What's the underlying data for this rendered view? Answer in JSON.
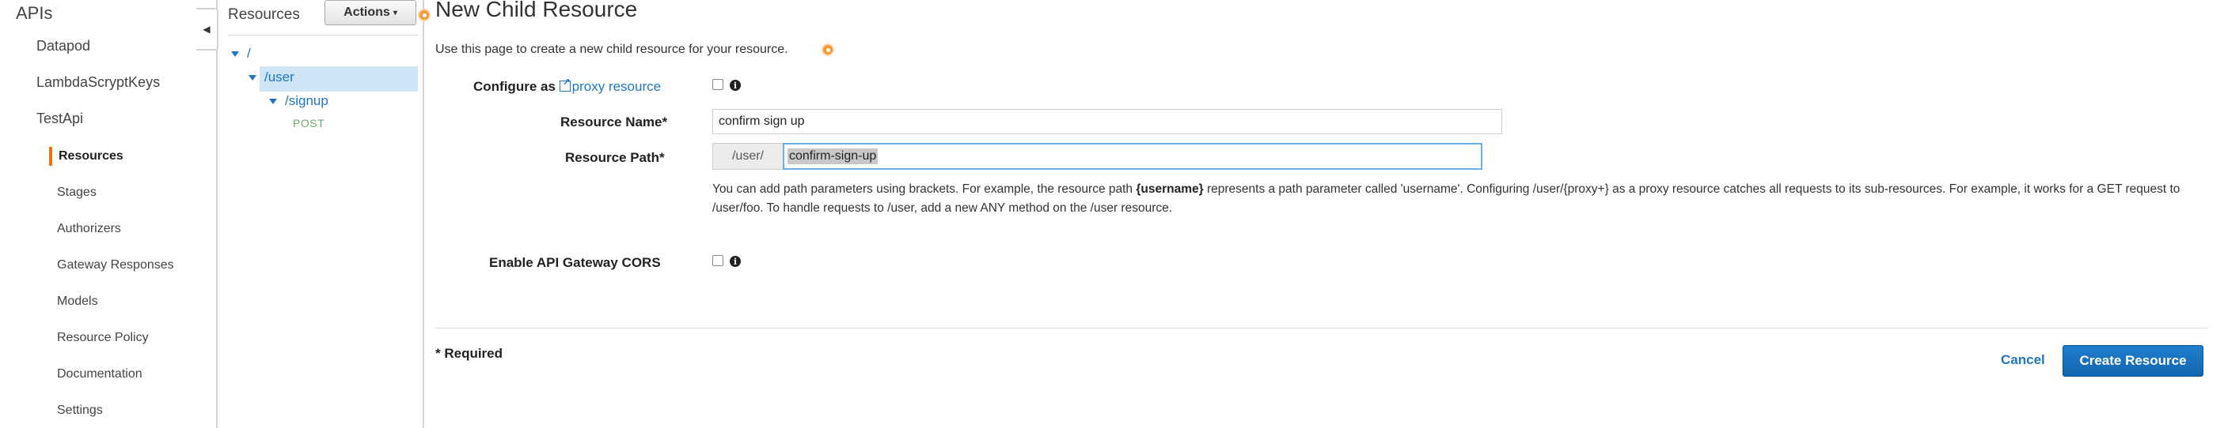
{
  "nav": {
    "apis_label": "APIs",
    "apis": [
      "Datapod",
      "LambdaScryptKeys",
      "TestApi"
    ],
    "sub_items": [
      "Resources",
      "Stages",
      "Authorizers",
      "Gateway Responses",
      "Models",
      "Resource Policy",
      "Documentation",
      "Settings"
    ],
    "active_sub": "Resources",
    "accent_color": "#ec7211"
  },
  "resources_panel": {
    "title": "Resources",
    "actions_label": "Actions",
    "tree": [
      {
        "label": "/"
      },
      {
        "label": "/user",
        "selected": true
      },
      {
        "label": "/signup"
      }
    ],
    "method_label": "POST"
  },
  "main": {
    "title": "New Child Resource",
    "intro": "Use this page to create a new child resource for your resource.",
    "configure_label": "Configure as",
    "proxy_link": "proxy resource",
    "resource_name_label": "Resource Name*",
    "resource_name_value": "confirm sign up",
    "resource_path_label": "Resource Path*",
    "resource_path_prefix": "/user/",
    "resource_path_value": "confirm-sign-up",
    "help_before": "You can add path parameters using brackets. For example, the resource path ",
    "help_bold": "{username}",
    "help_after": " represents a path parameter called 'username'. Configuring /user/{proxy+} as a proxy resource catches all requests to its sub-resources. For example, it works for a GET request to /user/foo. To handle requests to /user, add a new ANY method on the /user resource.",
    "cors_label": "Enable API Gateway CORS",
    "required_note": "* Required",
    "cancel_label": "Cancel",
    "create_label": "Create Resource",
    "primary_color": "#1f77c4"
  }
}
